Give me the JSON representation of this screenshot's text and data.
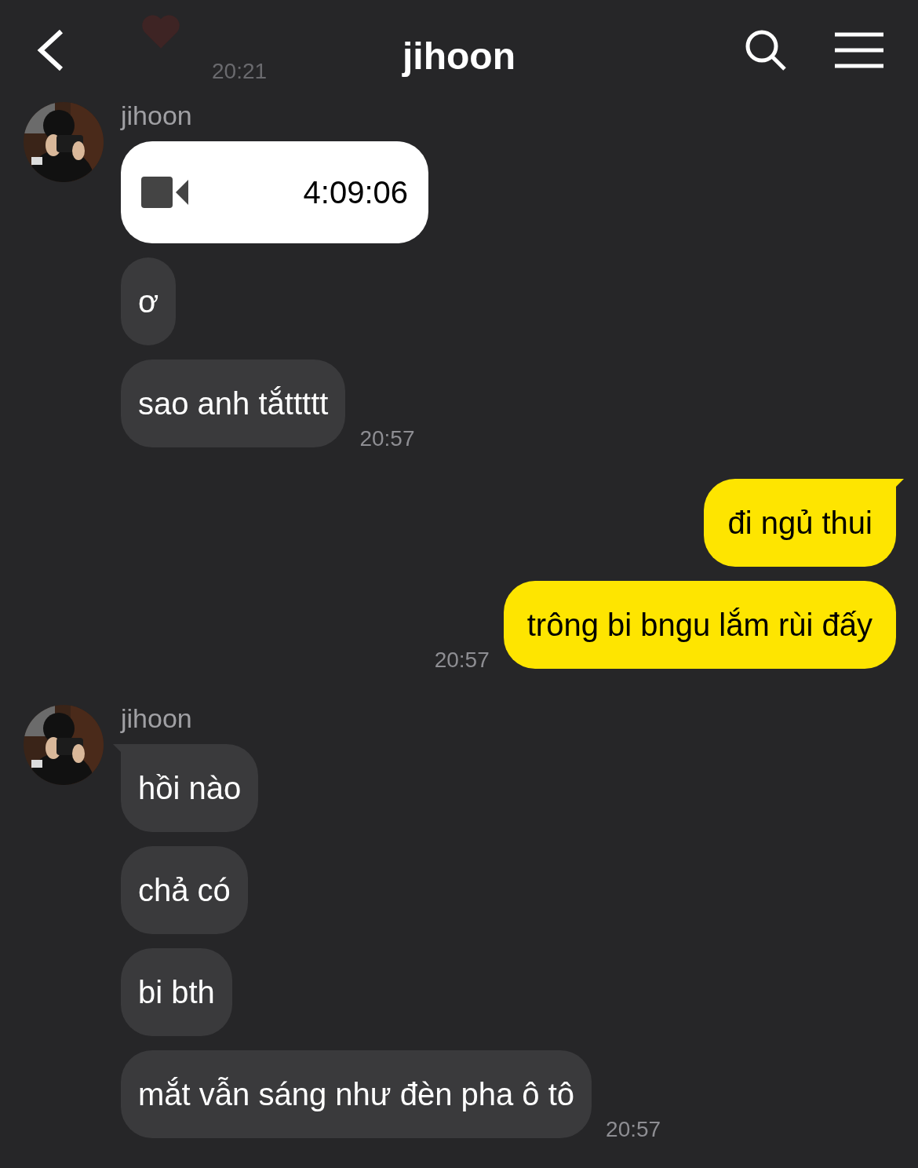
{
  "header": {
    "title": "jihoon",
    "behind_time": "20:21"
  },
  "groups": [
    {
      "kind": "received",
      "name": "jihoon",
      "messages": [
        {
          "kind": "call",
          "text": "4:09:06"
        },
        {
          "kind": "text",
          "text": "ơ",
          "tail": false
        },
        {
          "kind": "text",
          "text": "sao anh tắttttt",
          "tail": false,
          "time": "20:57"
        }
      ]
    },
    {
      "kind": "sent",
      "messages": [
        {
          "kind": "text",
          "text": "đi ngủ thui",
          "tail": true
        },
        {
          "kind": "text",
          "text": "trông bi bngu lắm rùi đấy",
          "tail": false,
          "time": "20:57"
        }
      ]
    },
    {
      "kind": "received",
      "name": "jihoon",
      "messages": [
        {
          "kind": "text",
          "text": "hồi nào",
          "tail": true
        },
        {
          "kind": "text",
          "text": "chả có",
          "tail": false
        },
        {
          "kind": "text",
          "text": "bi bth",
          "tail": false
        },
        {
          "kind": "text",
          "text": "mắt vẫn sáng như đèn pha ô tô",
          "tail": false,
          "time": "20:57"
        }
      ]
    }
  ]
}
